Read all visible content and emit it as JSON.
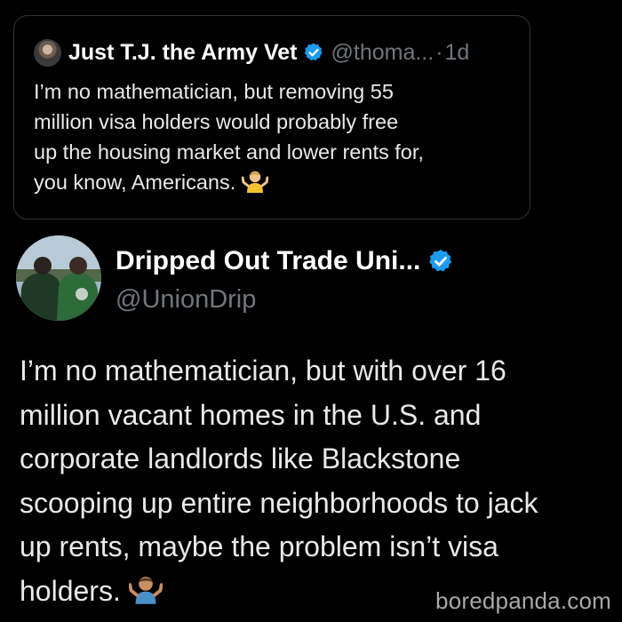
{
  "quoted_tweet": {
    "author_name": "Just T.J. the Army Vet",
    "handle": "@thoma...",
    "separator": "·",
    "time": "1d",
    "text": "I’m no mathematician, but removing 55\nmillion visa holders would probably free\nup the housing market and lower rents for,\nyou know, Americans.",
    "emoji": "person-shrugging-emoji"
  },
  "main_tweet": {
    "author_name": "Dripped Out Trade Uni...",
    "handle": "@UnionDrip",
    "text": "I’m no mathematician, but with over 16\nmillion vacant homes in the U.S. and\ncorporate landlords like Blackstone\nscooping up entire neighborhoods to jack\nup rents, maybe the problem isn’t visa\nholders.",
    "emoji": "person-shrugging-emoji"
  },
  "watermark": "boredpanda.com",
  "colors": {
    "background": "#000000",
    "text": "#e7e9ea",
    "secondary_text": "#71767b",
    "verified_badge": "#1d9bf0",
    "card_border": "#2f3336"
  }
}
